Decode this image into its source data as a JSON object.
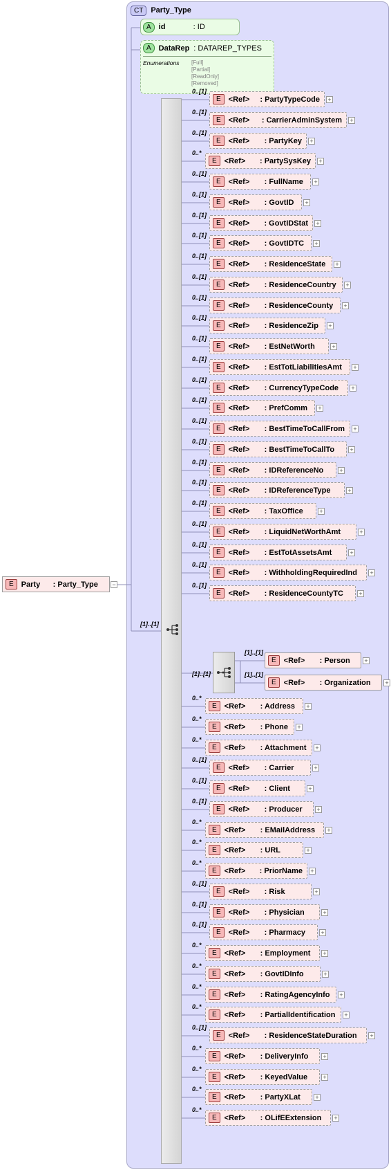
{
  "complex_type": {
    "badge": "CT",
    "name": "Party_Type"
  },
  "root_element": {
    "badge": "E",
    "name": "Party",
    "type": ": Party_Type"
  },
  "attributes": [
    {
      "badge": "A",
      "name": "id",
      "type": ": ID"
    },
    {
      "badge": "A",
      "name": "DataRep",
      "type": ": DATAREP_TYPES",
      "enumerations_label": "Enumerations",
      "enumerations": [
        "[Full]",
        "[Partial]",
        "[ReadOnly]",
        "[Removed]"
      ]
    }
  ],
  "sequence_cardinality": "[1]..[1]",
  "choice_cardinality": "[1]..[1]",
  "element_badge": "E",
  "ref_label": "<Ref>",
  "elements": [
    {
      "card": "0..[1]",
      "name": ": PartyTypeCode"
    },
    {
      "card": "0..[1]",
      "name": ": CarrierAdminSystem"
    },
    {
      "card": "0..[1]",
      "name": ": PartyKey"
    },
    {
      "card": "0..*",
      "name": ": PartySysKey"
    },
    {
      "card": "0..[1]",
      "name": ": FullName"
    },
    {
      "card": "0..[1]",
      "name": ": GovtID"
    },
    {
      "card": "0..[1]",
      "name": ": GovtIDStat"
    },
    {
      "card": "0..[1]",
      "name": ": GovtIDTC"
    },
    {
      "card": "0..[1]",
      "name": ": ResidenceState"
    },
    {
      "card": "0..[1]",
      "name": ": ResidenceCountry"
    },
    {
      "card": "0..[1]",
      "name": ": ResidenceCounty"
    },
    {
      "card": "0..[1]",
      "name": ": ResidenceZip"
    },
    {
      "card": "0..[1]",
      "name": ": EstNetWorth"
    },
    {
      "card": "0..[1]",
      "name": ": EstTotLiabilitiesAmt"
    },
    {
      "card": "0..[1]",
      "name": ": CurrencyTypeCode"
    },
    {
      "card": "0..[1]",
      "name": ": PrefComm"
    },
    {
      "card": "0..[1]",
      "name": ": BestTimeToCallFrom"
    },
    {
      "card": "0..[1]",
      "name": ": BestTimeToCallTo"
    },
    {
      "card": "0..[1]",
      "name": ": IDReferenceNo"
    },
    {
      "card": "0..[1]",
      "name": ": IDReferenceType"
    },
    {
      "card": "0..[1]",
      "name": ": TaxOffice"
    },
    {
      "card": "0..[1]",
      "name": ": LiquidNetWorthAmt"
    },
    {
      "card": "0..[1]",
      "name": ": EstTotAssetsAmt"
    },
    {
      "card": "0..[1]",
      "name": ": WithholdingRequiredInd"
    },
    {
      "card": "0..[1]",
      "name": ": ResidenceCountyTC"
    }
  ],
  "choice_elements": [
    {
      "card": "[1]..[1]",
      "name": ": Person"
    },
    {
      "card": "[1]..[1]",
      "name": ": Organization"
    }
  ],
  "elements_after": [
    {
      "card": "0..*",
      "name": ": Address"
    },
    {
      "card": "0..*",
      "name": ": Phone"
    },
    {
      "card": "0..*",
      "name": ": Attachment"
    },
    {
      "card": "0..[1]",
      "name": ": Carrier"
    },
    {
      "card": "0..[1]",
      "name": ": Client"
    },
    {
      "card": "0..[1]",
      "name": ": Producer"
    },
    {
      "card": "0..*",
      "name": ": EMailAddress"
    },
    {
      "card": "0..*",
      "name": ": URL"
    },
    {
      "card": "0..*",
      "name": ": PriorName"
    },
    {
      "card": "0..[1]",
      "name": ": Risk"
    },
    {
      "card": "0..[1]",
      "name": ": Physician"
    },
    {
      "card": "0..[1]",
      "name": ": Pharmacy"
    },
    {
      "card": "0..*",
      "name": ": Employment"
    },
    {
      "card": "0..*",
      "name": ": GovtIDInfo"
    },
    {
      "card": "0..*",
      "name": ": RatingAgencyInfo"
    },
    {
      "card": "0..*",
      "name": ": PartialIdentification"
    },
    {
      "card": "0..[1]",
      "name": ": ResidenceStateDuration"
    },
    {
      "card": "0..*",
      "name": ": DeliveryInfo"
    },
    {
      "card": "0..*",
      "name": ": KeyedValue"
    },
    {
      "card": "0..*",
      "name": ": PartyXLat"
    },
    {
      "card": "0..*",
      "name": ": OLifEExtension"
    }
  ],
  "colors": {
    "complex_type_bg": "#ddddfc",
    "element_bg": "#fdeaea",
    "attribute_bg": "#eafce5"
  }
}
